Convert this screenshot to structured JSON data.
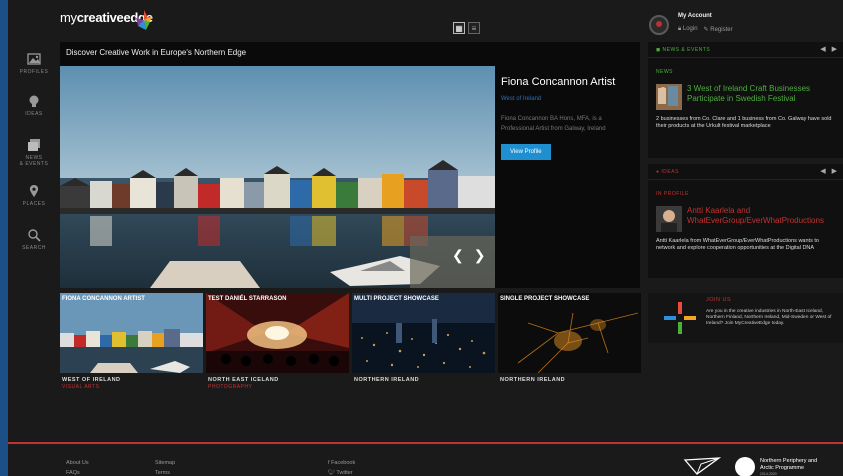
{
  "header": {
    "logo_text_light": "my",
    "logo_text_bold": "creativeedge",
    "account_title": "My Account",
    "login_label": "Login",
    "register_label": "Register"
  },
  "sidebar": {
    "items": [
      {
        "label": "PROFILES",
        "icon": "image-icon"
      },
      {
        "label": "IDEAS",
        "icon": "lightbulb-icon"
      },
      {
        "label": "NEWS",
        "label2": "& EVENTS",
        "icon": "news-icon"
      },
      {
        "label": "PLACES",
        "icon": "map-pin-icon"
      },
      {
        "label": "SEARCH",
        "icon": "search-icon"
      }
    ]
  },
  "hero": {
    "title": "Discover Creative Work in Europe's Northern Edge",
    "name": "Fiona Concannon Artist",
    "subtitle": "West of Ireland",
    "description": "Fiona Concannon BA Hons, MFA, is a Professional Artist from Galway, Ireland",
    "button": "View Profile"
  },
  "tiles": [
    {
      "title": "FIONA CONCANNON ARTIST",
      "location": "WEST OF IRELAND",
      "category": "VISUAL ARTS"
    },
    {
      "title": "TEST DANIÉL STARRASON",
      "location": "NORTH EAST ICELAND",
      "category": "PHOTOGRAPHY"
    },
    {
      "title": "MULTI PROJECT SHOWCASE",
      "location": "NORTHERN IRELAND",
      "category": ""
    },
    {
      "title": "SINGLE PROJECT SHOWCASE",
      "location": "NORTHERN IRELAND",
      "category": ""
    }
  ],
  "news_panel": {
    "header": "NEWS & EVENTS",
    "section": "NEWS",
    "headline": "3 West of Ireland Craft Businesses Participate in Swedish Festival",
    "text": "2 businesses from Co. Clare and 1 business from Co. Galway have sold their products at the Urkult festival marketplace"
  },
  "ideas_panel": {
    "header": "IDEAS",
    "section": "IN PROFILE",
    "headline": "Antti Kaarlela and WhatEverGroup/EverWhatProductions",
    "text": "Antti Kaarlela from WhatEverGroup/EverWhatProductions wants to network and explore cooperation opportunities at the Digital DNA"
  },
  "join": {
    "title": "JOIN US",
    "text": "Are you in the creative industries in North-East Iceland, Northern Finland, Northern Ireland, Mid-Sweden or West of Ireland? Join MyCreativeEdge today."
  },
  "footer": {
    "about": "About Us",
    "faqs": "FAQs",
    "sitemap": "Sitemap",
    "terms": "Terms",
    "facebook": "Facebook",
    "twitter": "Twitter",
    "npa_line1": "Northern Periphery and",
    "npa_line2": "Arctic Programme",
    "npa_sub": "2014-2020"
  },
  "colors": {
    "accent_red": "#c23232",
    "accent_green": "#4caf3c",
    "button_blue": "#1f8fcf"
  }
}
